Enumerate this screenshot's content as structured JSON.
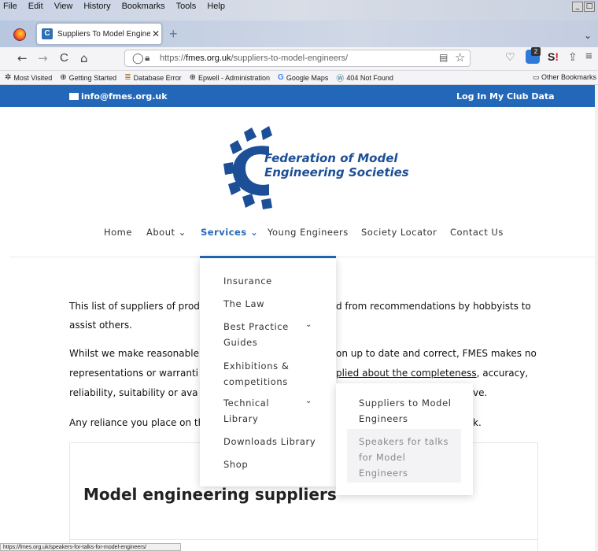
{
  "menubar": {
    "items": [
      "File",
      "Edit",
      "View",
      "History",
      "Bookmarks",
      "Tools",
      "Help"
    ]
  },
  "tab": {
    "favicon_letter": "C",
    "title": "Suppliers To Model Engineers | Fed",
    "close": "✕",
    "new_tab": "+"
  },
  "nav": {
    "back": "←",
    "forward": "→",
    "reload": "C",
    "home": "⌂",
    "url_prefix": "https://",
    "url_domain": "fmes.org.uk",
    "url_path": "/suppliers-to-model-engineers/",
    "ext_badge": "2"
  },
  "bookmarks": {
    "items": [
      {
        "label": "Most Visited",
        "icon": "gear-icon"
      },
      {
        "label": "Getting Started",
        "icon": "globe-icon"
      },
      {
        "label": "Database Error",
        "icon": "list-icon"
      },
      {
        "label": "Epwell - Administration",
        "icon": "globe-icon"
      },
      {
        "label": "Google Maps",
        "icon": "google-icon"
      },
      {
        "label": "404 Not Found",
        "icon": "wordpress-icon"
      }
    ],
    "other": "Other Bookmarks"
  },
  "site": {
    "email": "info@fmes.org.uk",
    "login": "Log In",
    "my_club": "My Club Data",
    "logo_line1": "Federation of Model",
    "logo_line2": "Engineering Societies",
    "brand_color": "#2368b8"
  },
  "mainnav": {
    "home": "Home",
    "about": "About",
    "services": "Services",
    "young": "Young Engineers",
    "locator": "Society Locator",
    "contact": "Contact Us",
    "chevron": "⌄"
  },
  "dropdown": {
    "insurance": "Insurance",
    "law": "The Law",
    "best1": "Best Practice",
    "best2": "Guides",
    "exh1": "Exhibitions &",
    "exh2": "competitions",
    "tech1": "Technical",
    "tech2": "Library",
    "downloads": "Downloads Library",
    "shop": "Shop",
    "chevron": "⌄"
  },
  "submenu": {
    "suppliers1": "Suppliers to Model",
    "suppliers2": "Engineers",
    "speakers1": "Speakers for talks",
    "speakers2": "for Model",
    "speakers3": "Engineers"
  },
  "content": {
    "p1a": "This list of suppliers of prod",
    "p1b": "d from recommendations by hobbyists to",
    "p1c": "assist others.",
    "p2a": "Whilst we make reasonable",
    "p2b": "on up to date and correct, FMES makes no",
    "p2c": "representations or warranti",
    "p2d_link": "plied about the completeness",
    "p2d_rest": ", accuracy,",
    "p2e": "reliability, suitability or ava",
    "p2f": "ve.",
    "p3a": "Any reliance you place on th",
    "p3b": "k.",
    "heading": "Model engineering suppliers"
  },
  "status": {
    "url": "https://fmes.org.uk/speakers-for-talks-for-model-engineers/"
  }
}
